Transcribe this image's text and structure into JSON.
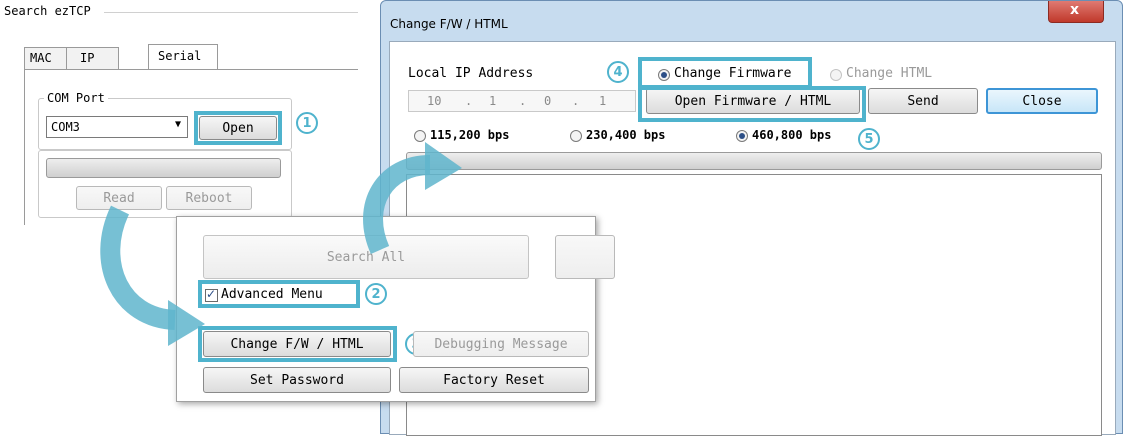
{
  "left_panel": {
    "group_title": "Search ezTCP",
    "tabs": [
      "MAC",
      "IP",
      "Serial"
    ],
    "com_port_legend": "COM Port",
    "com_port_value": "COM3",
    "open_button": "Open",
    "read_button": "Read",
    "reboot_button": "Reboot"
  },
  "middle_panel": {
    "search_all_button": "Search All",
    "advanced_menu_label": "Advanced Menu",
    "advanced_menu_checked": true,
    "change_fw_button": "Change F/W / HTML",
    "debugging_button": "Debugging Message",
    "set_password_button": "Set Password",
    "factory_reset_button": "Factory Reset"
  },
  "dialog": {
    "title": "Change F/W / HTML",
    "close_icon": "x-icon",
    "local_ip_label": "Local IP Address",
    "ip_octets": [
      "10",
      "1",
      "0",
      "1"
    ],
    "change_firmware_label": "Change Firmware",
    "change_html_label": "Change HTML",
    "selected_mode": "Change Firmware",
    "open_fw_button": "Open Firmware / HTML",
    "send_button": "Send",
    "close_button": "Close",
    "baud_rates": [
      "115,200 bps",
      "230,400 bps",
      "460,800 bps"
    ],
    "selected_baud": "460,800 bps"
  },
  "steps": [
    "1",
    "2",
    "3",
    "4",
    "5"
  ],
  "colors": {
    "highlight": "#4fb3cd",
    "title_bar": "#c7dcef",
    "close_button": "#c7514a"
  }
}
